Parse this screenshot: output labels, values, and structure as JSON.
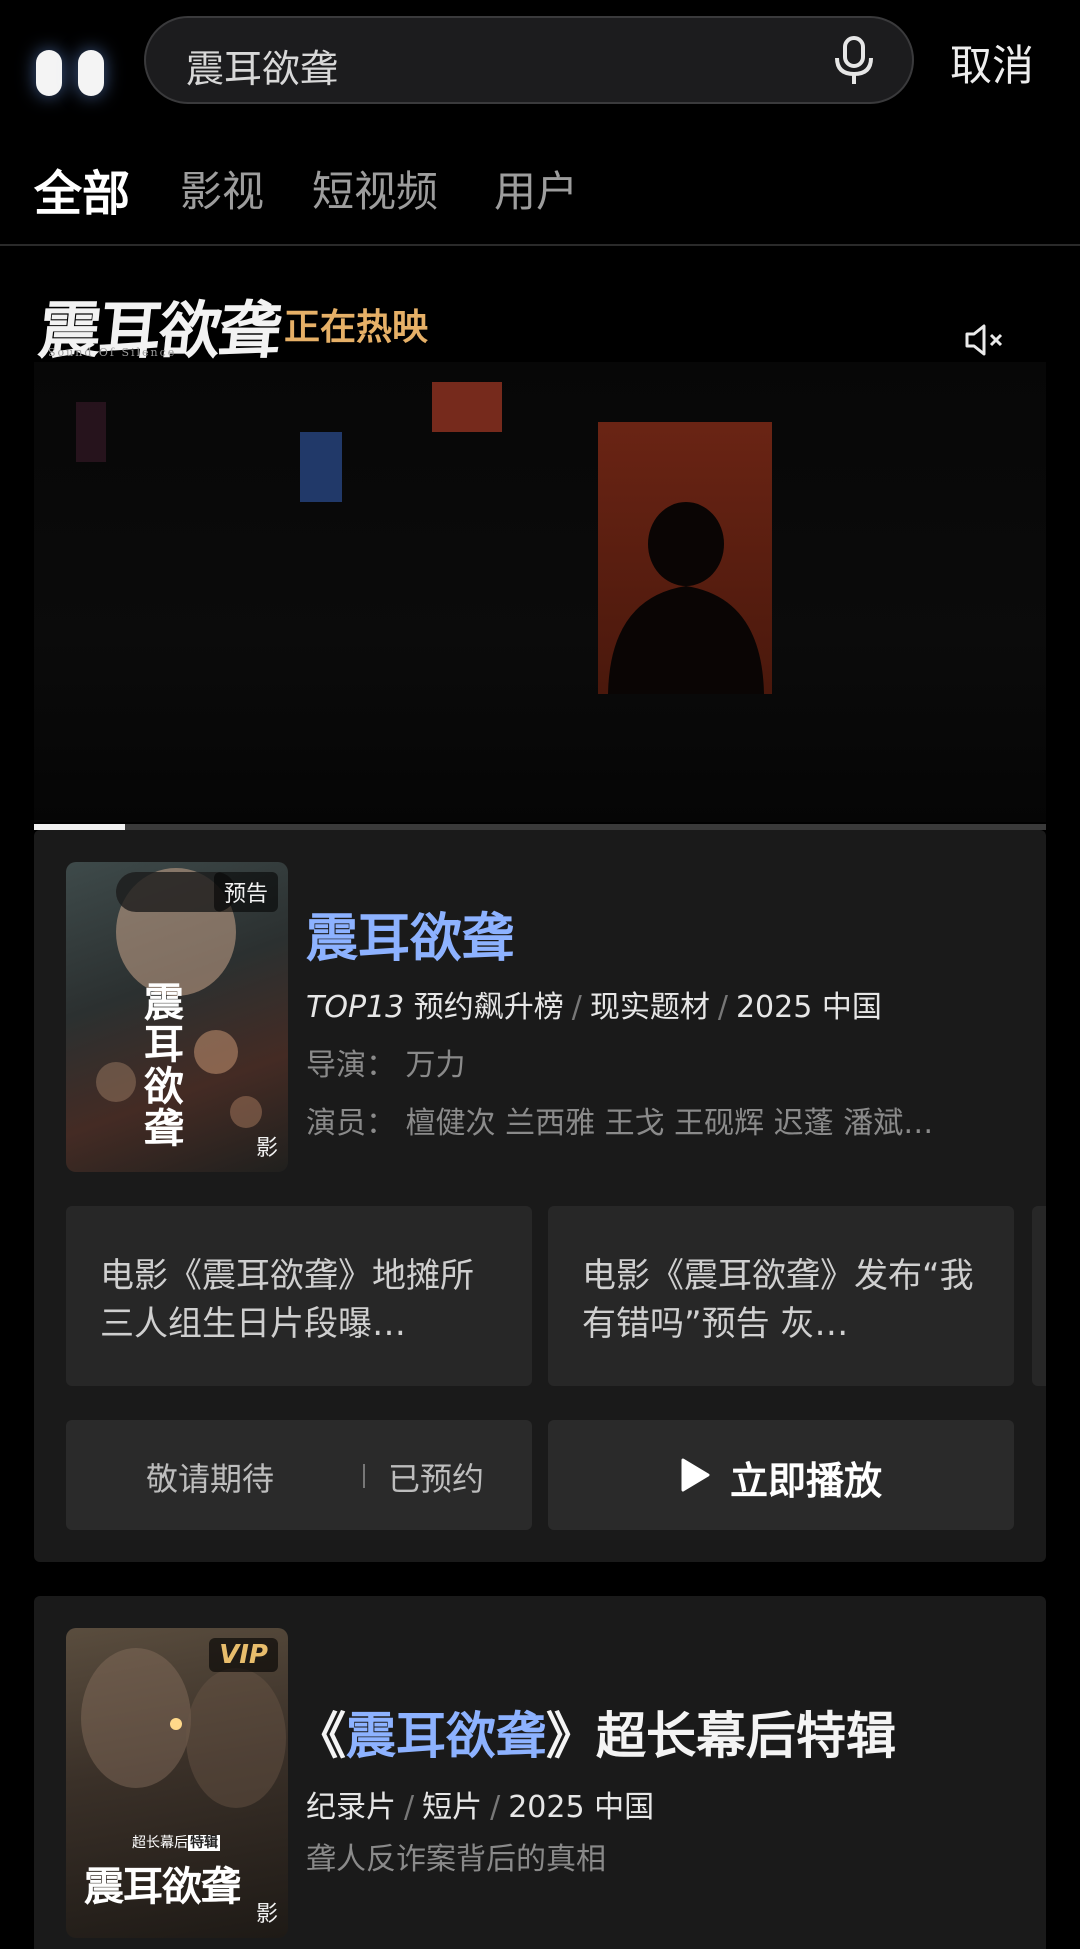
{
  "search": {
    "query": "震耳欲聋",
    "cancel_label": "取消"
  },
  "tabs": [
    {
      "label": "全部",
      "active": true
    },
    {
      "label": "影视",
      "active": false
    },
    {
      "label": "短视频",
      "active": false
    },
    {
      "label": "用户",
      "active": false
    }
  ],
  "banner": {
    "title": "震耳欲聋",
    "subtitle": "Sound Of Silence",
    "tag": "正在热映",
    "video_progress": 0.09
  },
  "movie": {
    "poster_badge": "预告",
    "poster_title": "震耳欲聋",
    "poster_corner": "影",
    "title": "震耳欲聋",
    "meta": {
      "rank": "TOP13",
      "rank_list": "预约飙升榜",
      "genre": "现实题材",
      "year_region": "2025 中国"
    },
    "director": "导演：  万力",
    "cast": "演员：  檀健次 兰西雅 王戈 王砚辉 迟蓬 潘斌…",
    "news": [
      "电影《震耳欲聋》地摊所三人组生日片段曝…",
      "电影《震耳欲聋》发布“我有错吗”预告 灰…"
    ],
    "buttons": {
      "expect": "敬请期待",
      "reserved": "已预约",
      "play": "立即播放"
    }
  },
  "special": {
    "badge": "VIP",
    "poster_sub_a": "超长幕后",
    "poster_sub_b": "特辑",
    "poster_title": "震耳欲聋",
    "poster_corner": "影",
    "title_open": "《",
    "title_hl": "震耳欲聋",
    "title_rest": "》超长幕后特辑",
    "meta": [
      "纪录片",
      "短片",
      "2025 中国"
    ],
    "desc": "聋人反诈案背后的真相"
  },
  "colors": {
    "accent_blue": "#8db2ff",
    "tag_gold": "#e6b067",
    "card_bg": "#1a1a1a"
  }
}
